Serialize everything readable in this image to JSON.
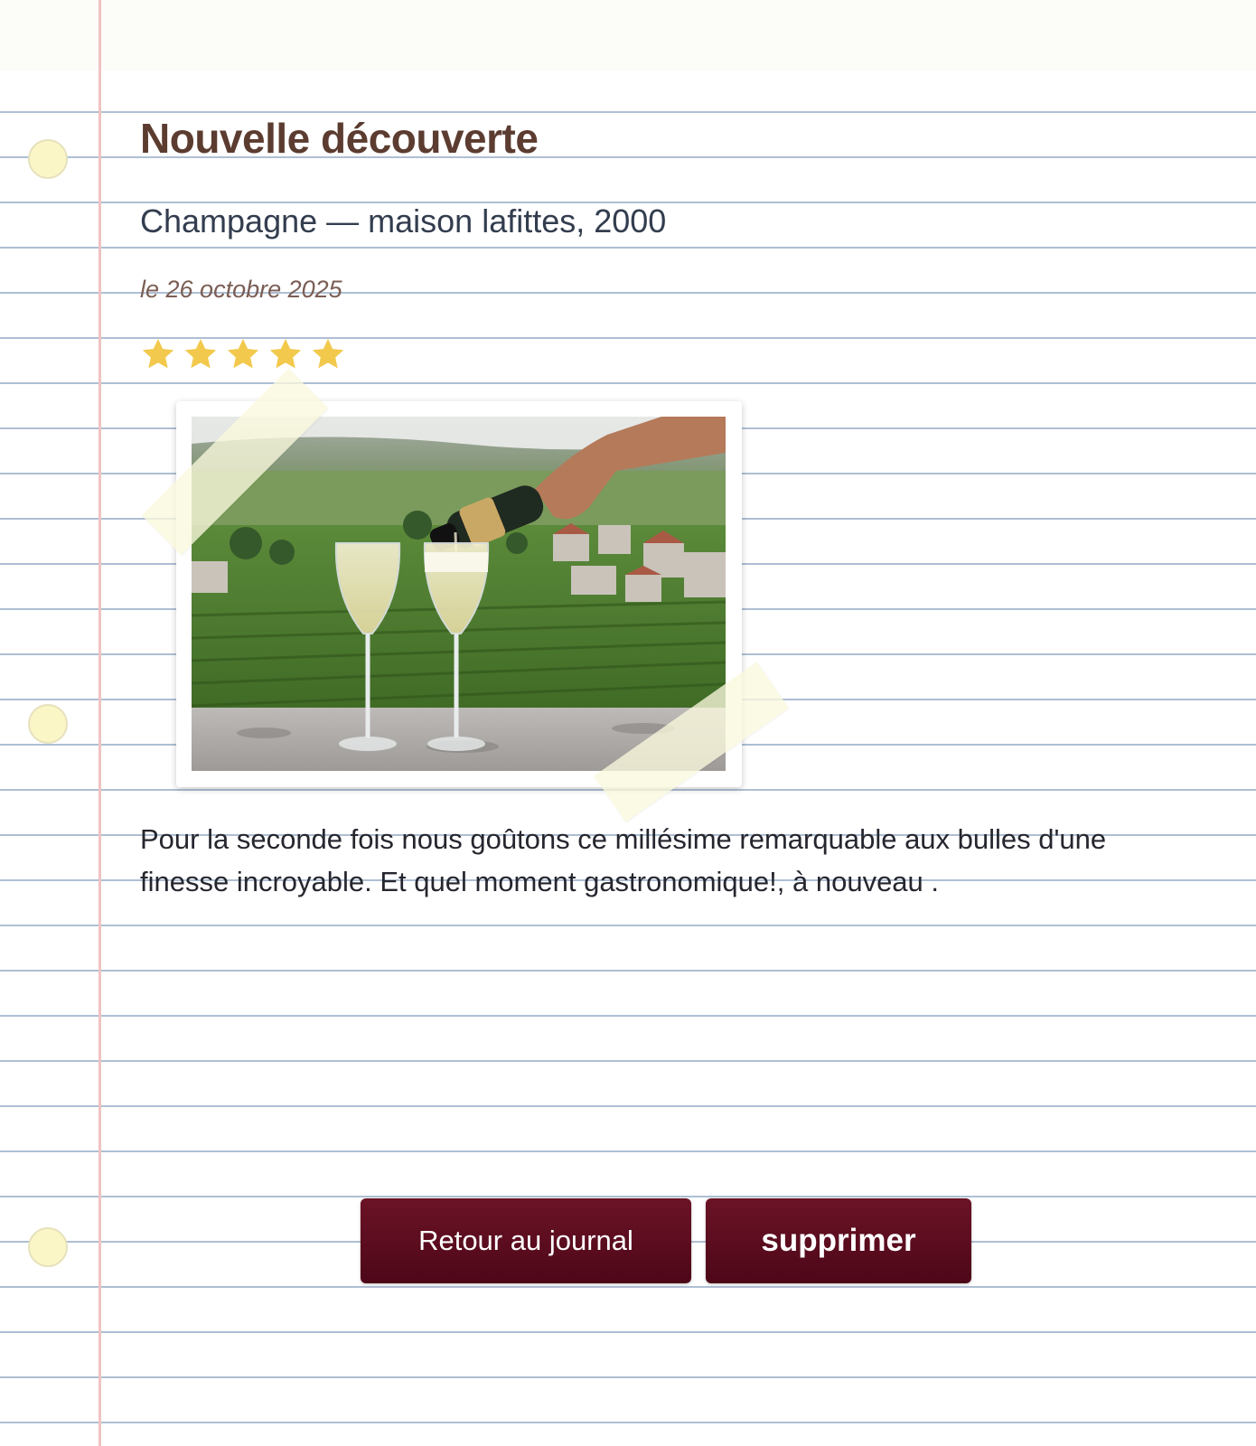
{
  "entry": {
    "title": "Nouvelle découverte",
    "subtitle": "Champagne — maison lafittes, 2000",
    "date": "le 26 octobre 2025",
    "rating": 5,
    "rating_max": 5,
    "photo_icon": "champagne-pouring-vineyard-photo",
    "text": "Pour la seconde fois nous goûtons ce millésime remarquable aux bulles d'une finesse incroyable. Et quel moment gastronomique!, à nouveau ."
  },
  "actions": {
    "back_label": "Retour au journal",
    "delete_label": "supprimer"
  },
  "colors": {
    "title": "#5c3c30",
    "star": "#f2c94c",
    "button": "#5a0c1f",
    "margin_line": "#efc3c3",
    "rule_line": "#aebfd3"
  }
}
